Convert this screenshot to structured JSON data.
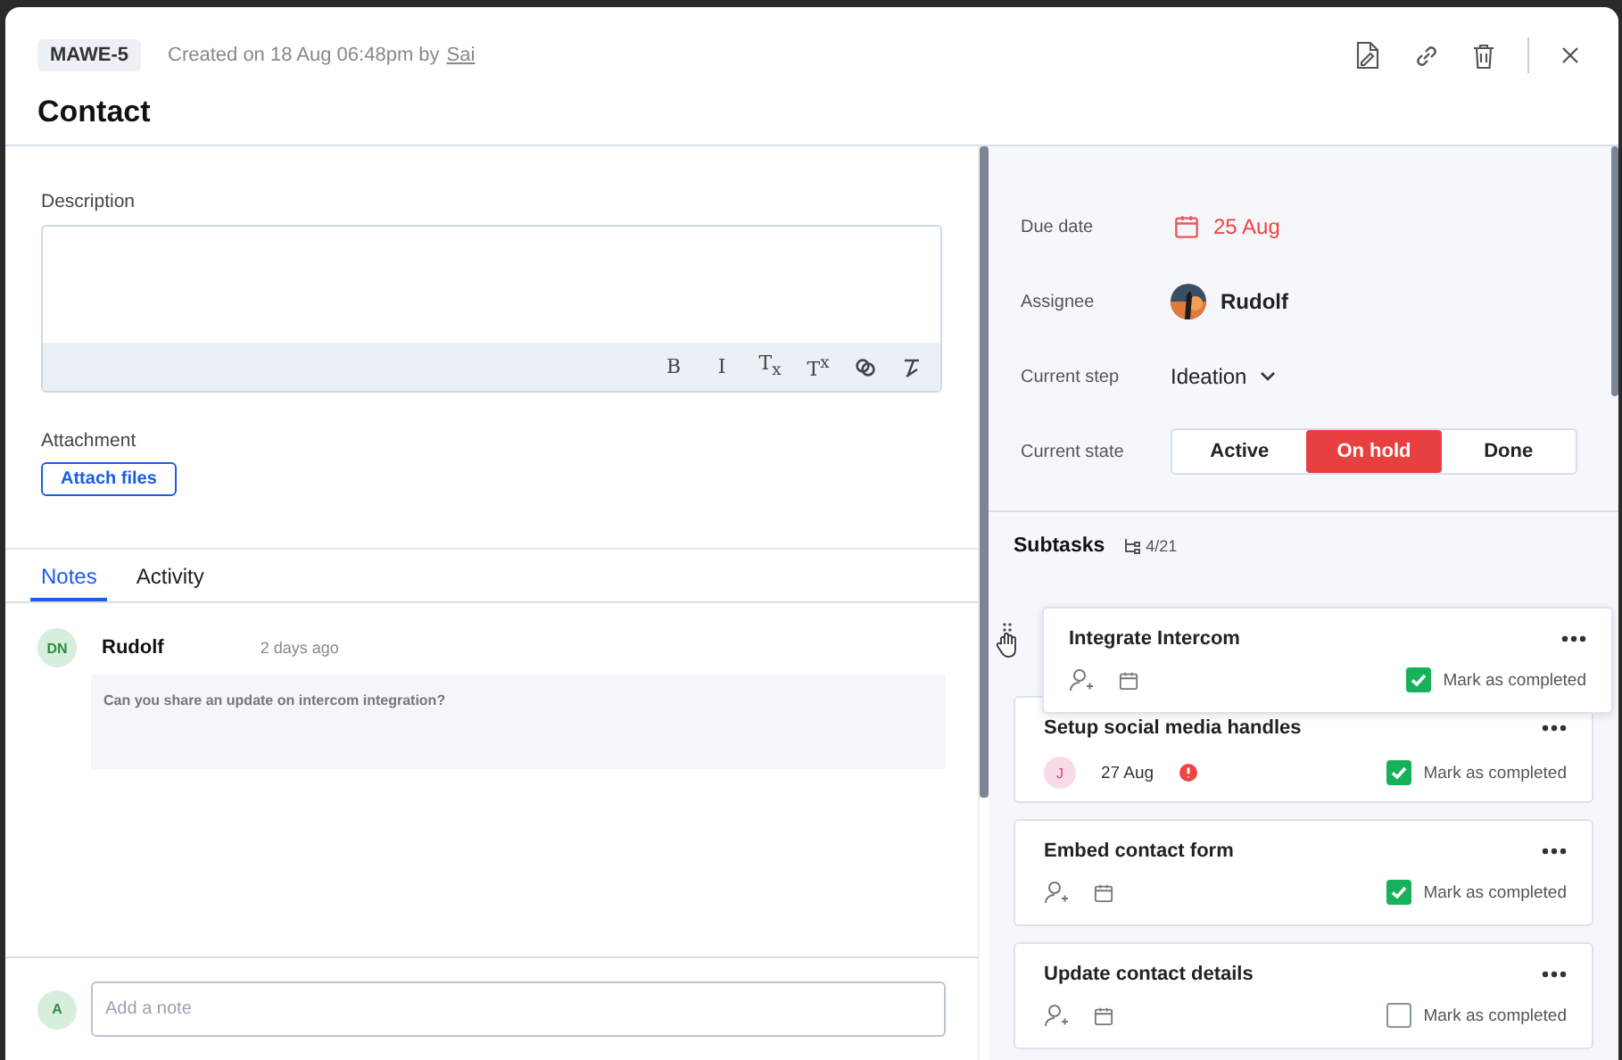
{
  "header": {
    "badge": "MAWE-5",
    "created": "Created on 18 Aug 06:48pm by",
    "author": "Sai",
    "title": "Contact"
  },
  "description": {
    "label": "Description",
    "tools": [
      {
        "kind": "text",
        "label": "B"
      },
      {
        "kind": "text",
        "label": "I"
      },
      {
        "kind": "text",
        "label": "T$_{x}$"
      },
      {
        "kind": "text",
        "label": "T$^{x}$"
      },
      {
        "kind": "link"
      },
      {
        "kind": "clear"
      }
    ]
  },
  "attachment": {
    "label": "Attachment",
    "button": "Attach files"
  },
  "tabs": [
    {
      "label": "Notes",
      "selected": true
    },
    {
      "label": "Activity",
      "selected": false
    }
  ],
  "notes": [
    {
      "initials": "DN",
      "author": "Rudolf",
      "time": "2 days ago",
      "text": "Can you share an update on intercom integration?"
    }
  ],
  "composer": {
    "initials": "A",
    "placeholder": "Add a note"
  },
  "details": {
    "due_label": "Due date",
    "due": "25 Aug",
    "overdue": true,
    "assignee_label": "Assignee",
    "assignee": "Rudolf",
    "step_label": "Current step",
    "step": "Ideation",
    "state_label": "Current state",
    "states": [
      {
        "label": "Active",
        "selected": false
      },
      {
        "label": "On hold",
        "selected": true
      },
      {
        "label": "Done",
        "selected": false
      }
    ]
  },
  "subtasks": {
    "title": "Subtasks",
    "count": "4/21",
    "items": [
      {
        "title": "Integrate Intercom",
        "dragging": true,
        "completed": true,
        "mark": "Mark as completed"
      },
      {
        "title": "Setup social media handles",
        "dragging": false,
        "assignee": "J",
        "date": "27 Aug",
        "overdue": true,
        "completed": true,
        "mark": "Mark as completed"
      },
      {
        "title": "Embed contact form",
        "dragging": false,
        "completed": true,
        "mark": "Mark as completed"
      },
      {
        "title": "Update contact details",
        "dragging": false,
        "completed": false,
        "mark": "Mark as completed"
      }
    ]
  }
}
